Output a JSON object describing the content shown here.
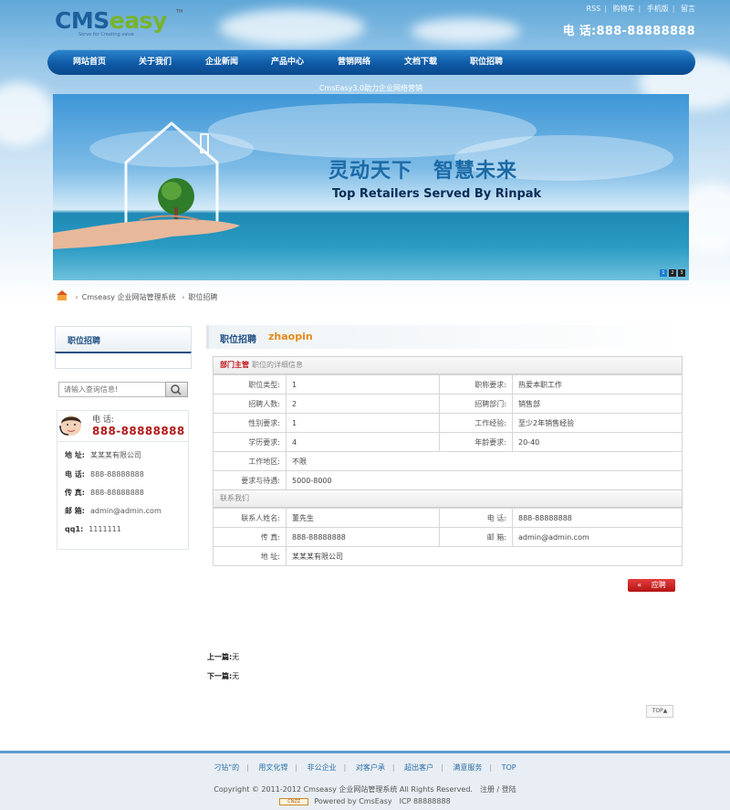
{
  "header": {
    "logo_text_a": "CMS",
    "logo_text_b": "easy",
    "logo_tm": "TM",
    "logo_slogan": "Serve for Creating value",
    "toplinks": [
      "RSS",
      "购物车",
      "手机版",
      "留言"
    ],
    "tel": "电 话:888-88888888"
  },
  "nav": {
    "items": [
      "网站首页",
      "关于我们",
      "企业新闻",
      "产品中心",
      "营销网络",
      "文档下载",
      "职位招聘"
    ]
  },
  "banner": {
    "caption": "CmsEasy3.0助力企业网络营销",
    "headline": "灵动天下　智慧未来",
    "subline": "Top Retailers Served By Rinpak",
    "dots": [
      "1",
      "2",
      "3"
    ]
  },
  "breadcrumb": {
    "items": [
      "Cmseasy 企业网站管理系统",
      "职位招聘"
    ]
  },
  "sidebar": {
    "title": "职位招聘",
    "search_placeholder": "请输入查询信息!",
    "contact_label": "电 话:",
    "contact_tel": "888-88888888",
    "rows": [
      {
        "k": "地 址:",
        "v": "某某某有限公司"
      },
      {
        "k": "电 话:",
        "v": "888-88888888"
      },
      {
        "k": "传 真:",
        "v": "888-88888888"
      },
      {
        "k": "邮 箱:",
        "v": "admin@admin.com"
      },
      {
        "k": "qq1:",
        "v": "1111111"
      }
    ]
  },
  "main": {
    "title": "职位招聘",
    "subtitle": "zhaopin",
    "job_name": "部门主管",
    "detail_label": "职位的详细信息",
    "details": [
      {
        "k1": "职位类型:",
        "v1": "1",
        "k2": "职称要求:",
        "v2": "热爱本职工作"
      },
      {
        "k1": "招聘人数:",
        "v1": "2",
        "k2": "招聘部门:",
        "v2": "销售部"
      },
      {
        "k1": "性别要求:",
        "v1": "1",
        "k2": "工作经验:",
        "v2": "至少2年销售经验"
      },
      {
        "k1": "学历要求:",
        "v1": "4",
        "k2": "年龄要求:",
        "v2": "20-40"
      }
    ],
    "area_label": "工作地区:",
    "area_value": "不限",
    "salary_label": "要求与待遇:",
    "salary_value": "5000-8000",
    "contact_section": "联系我们",
    "contact": {
      "name_k": "联系人姓名:",
      "name_v": "董先生",
      "tel_k": "电 话:",
      "tel_v": "888-88888888",
      "fax_k": "传 真:",
      "fax_v": "888-88888888",
      "mail_k": "邮 箱:",
      "mail_v": "admin@admin.com",
      "addr_k": "地 址:",
      "addr_v": "某某某有限公司"
    },
    "apply_label": "« 　应聘",
    "prev": {
      "k": "上一篇:",
      "v": "无"
    },
    "next": {
      "k": "下一篇:",
      "v": "无"
    },
    "top_label": "TOP▲"
  },
  "footer": {
    "links": [
      "刁钻\"的",
      "用文化锝",
      "非公企业",
      "对客户承",
      "超出客户",
      "满意服务",
      "TOP"
    ],
    "copyright": "Copyright © 2011-2012 Cmseasy 企业网站管理系统 All Rights Reserved.　注册 / 登陆",
    "cnzz": "CNZZ",
    "powered": "Powered by CmsEasy　ICP 88888888"
  },
  "colors": {
    "nav": "#0f5aa6",
    "accent_red": "#b01c1c",
    "accent_orange": "#e58a1a",
    "title_blue": "#1d4f82"
  }
}
